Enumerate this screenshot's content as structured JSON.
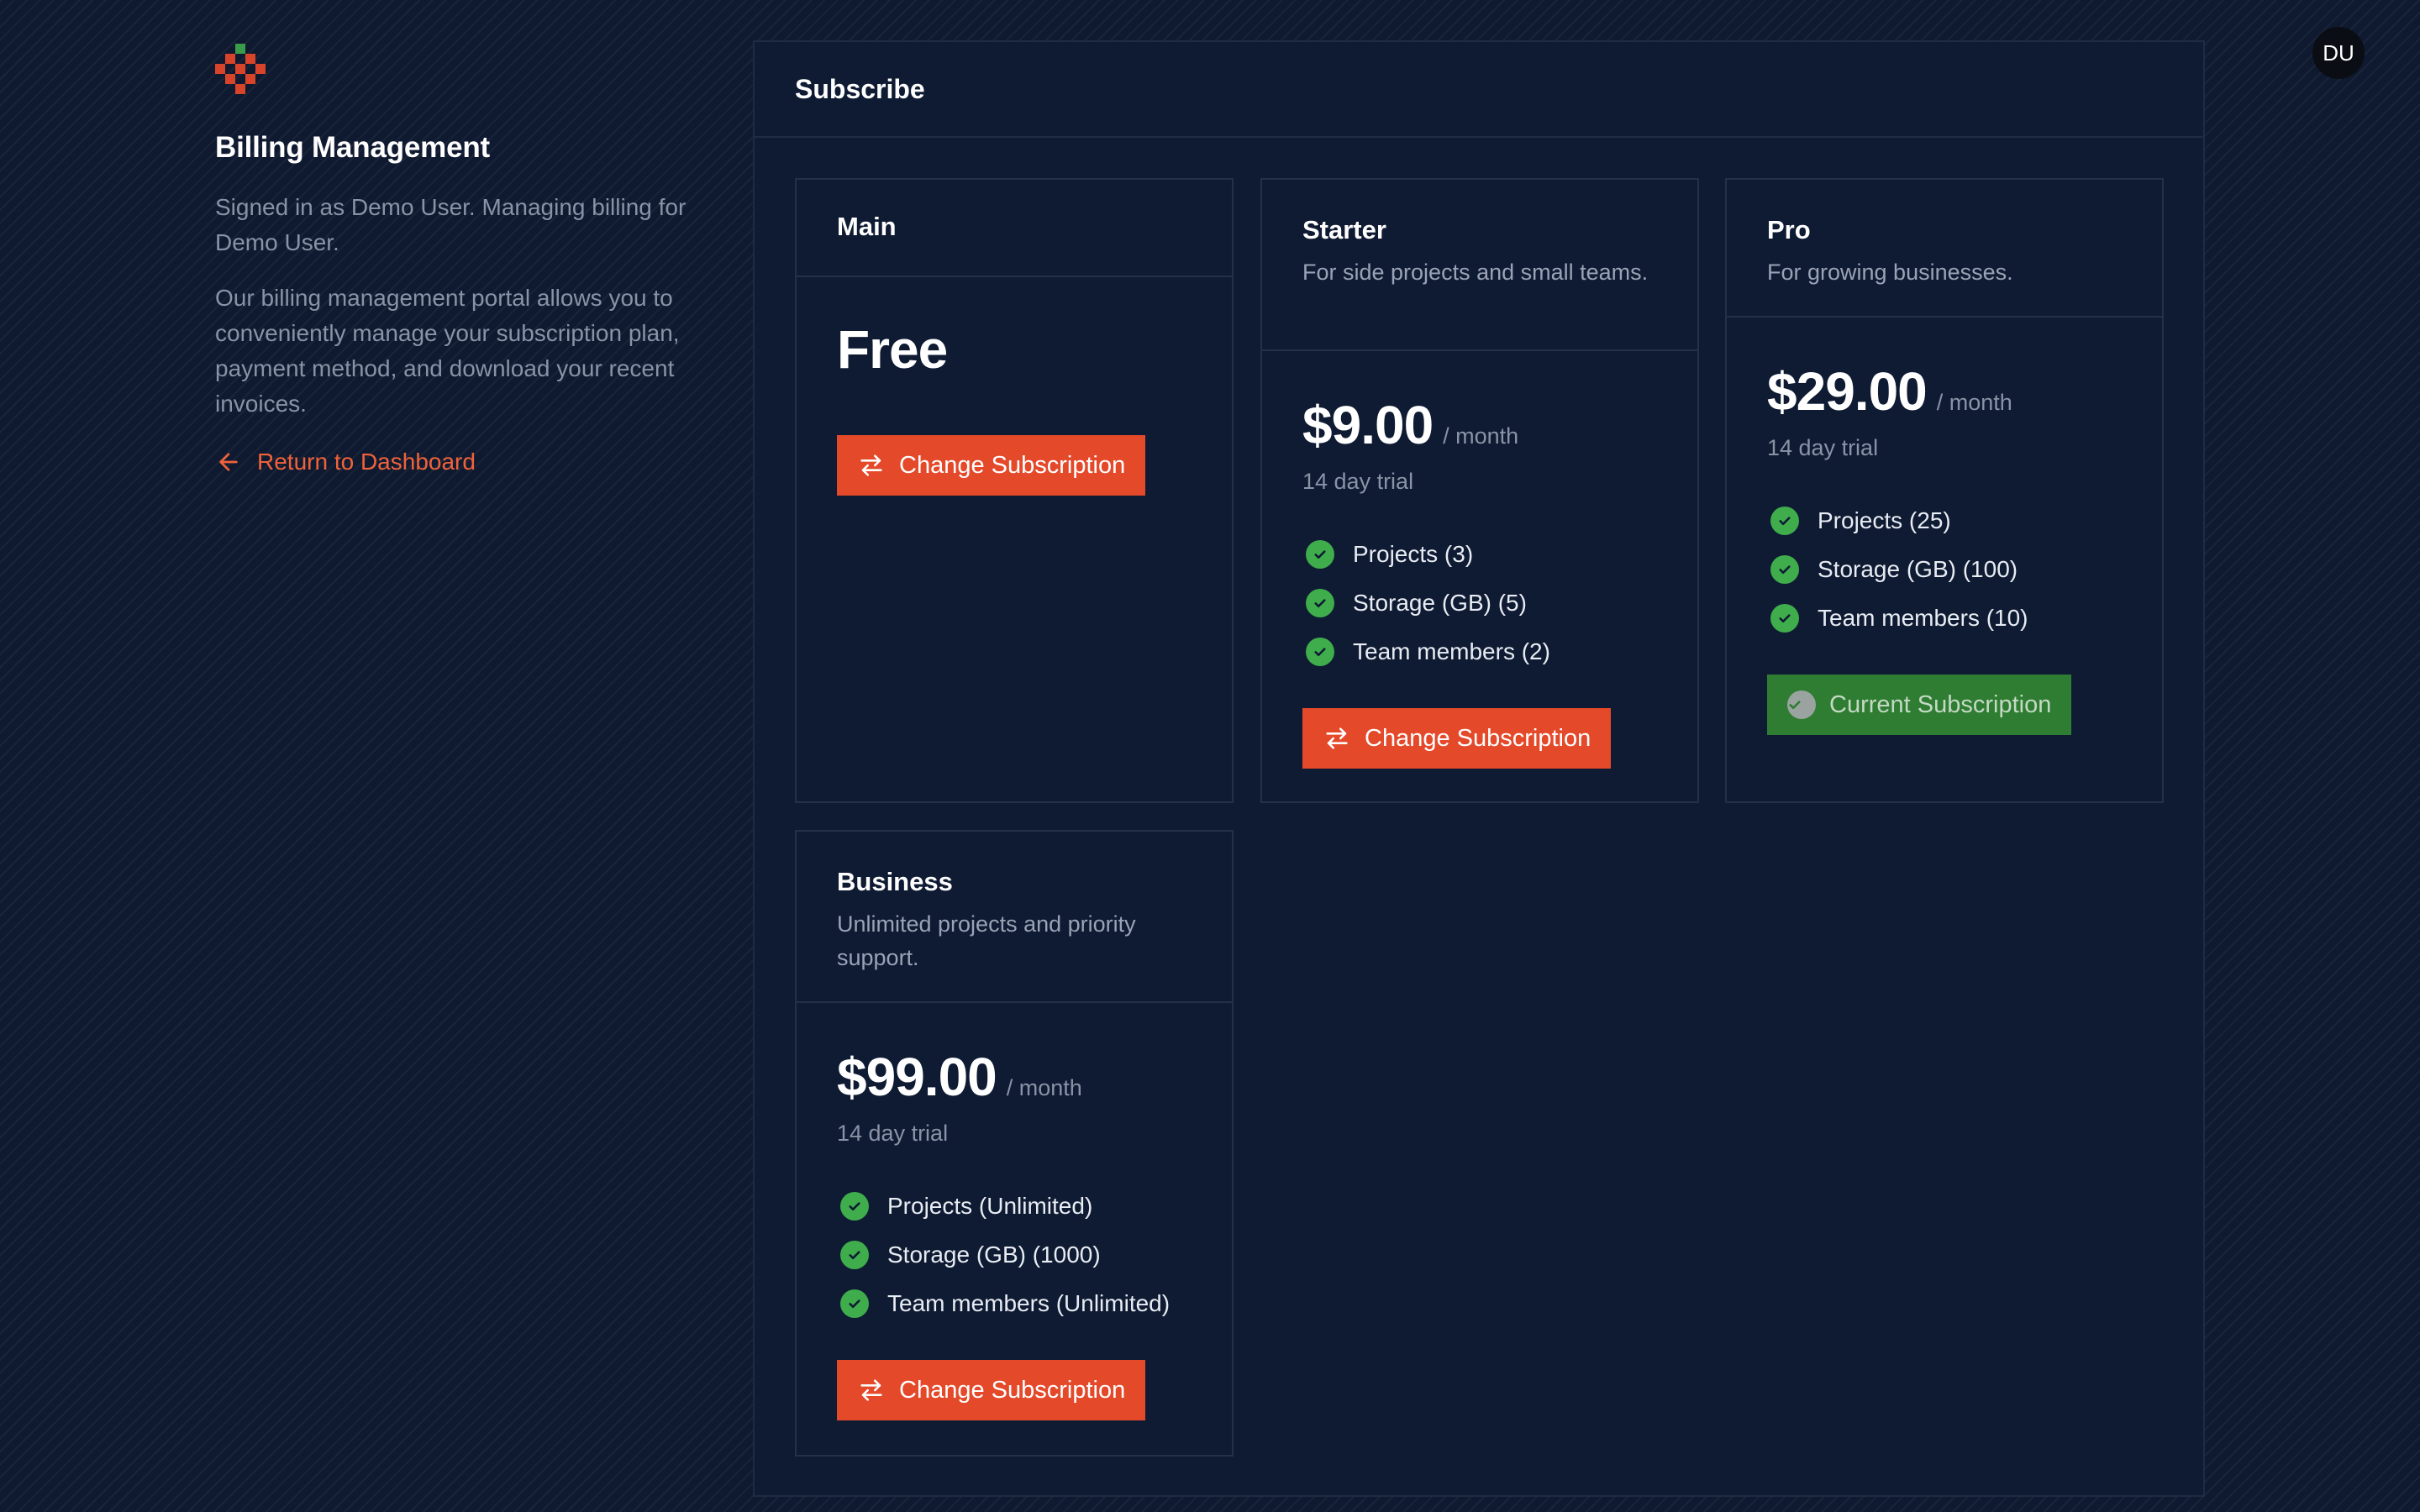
{
  "sidebar": {
    "title": "Billing Management",
    "signed_in_text": "Signed in as Demo User. Managing billing for Demo User.",
    "description": "Our billing management portal allows you to conveniently manage your subscription plan, payment method, and download your recent invoices.",
    "return_link": "Return to Dashboard"
  },
  "avatar": {
    "initials": "DU"
  },
  "panel": {
    "title": "Subscribe"
  },
  "plans": [
    {
      "name": "Main",
      "description": "",
      "price": "Free",
      "button": "Change Subscription"
    },
    {
      "name": "Starter",
      "description": "For side projects and small teams.",
      "price": "$9.00",
      "period": "/ month",
      "trial": "14 day trial",
      "features": [
        "Projects (3)",
        "Storage (GB) (5)",
        "Team members (2)"
      ],
      "button": "Change Subscription"
    },
    {
      "name": "Pro",
      "description": "For growing businesses.",
      "price": "$29.00",
      "period": "/ month",
      "trial": "14 day trial",
      "features": [
        "Projects (25)",
        "Storage (GB) (100)",
        "Team members (10)"
      ],
      "button": "Current Subscription",
      "is_current": true
    },
    {
      "name": "Business",
      "description": "Unlimited projects and priority support.",
      "price": "$99.00",
      "period": "/ month",
      "trial": "14 day trial",
      "features": [
        "Projects (Unlimited)",
        "Storage (GB) (1000)",
        "Team members (Unlimited)"
      ],
      "button": "Change Subscription"
    }
  ],
  "colors": {
    "background": "#0f1a30",
    "accent": "#e4492a",
    "link": "#f0623a",
    "success": "#3fad4c",
    "current_button": "#2e7d32"
  }
}
